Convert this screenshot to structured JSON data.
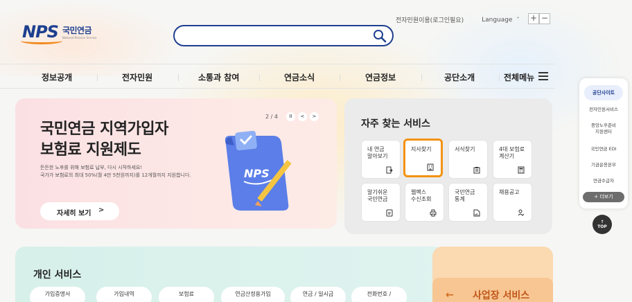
{
  "header": {
    "logo_text": "NPS",
    "logo_kr": "국민연금",
    "logo_en": "National Pension Service",
    "search_placeholder": "",
    "util_login": "전자민원이용(로그인필요)",
    "util_language": "Language",
    "zoom_in": "+",
    "zoom_out": "−"
  },
  "nav": {
    "items": [
      "정보공개",
      "전자민원",
      "소통과 참여",
      "연금소식",
      "연금정보",
      "공단소개",
      "전체메뉴"
    ]
  },
  "hero": {
    "title_line1": "국민연금 지역가입자",
    "title_line2": "보험료 지원제도",
    "desc_line1": "든든한 노후를 위해 보험료 납부, 다시 시작하세요!",
    "desc_line2": "국가가 보험료의 최대 50%(월 4만 5천원까지)를 12개월까지 지원합니다.",
    "button_label": "자세히 보기",
    "button_arrow": ">",
    "pager": "2 / 4",
    "pause": "II",
    "prev": "<",
    "next": ">",
    "illust_logo": "NPS"
  },
  "frequent": {
    "title": "자주 찾는 서비스",
    "tiles": [
      {
        "label": "내 연금\n알아보기",
        "icon": "document-arrow-icon"
      },
      {
        "label": "지사찾기",
        "icon": "building-icon"
      },
      {
        "label": "서식찾기",
        "icon": "clipboard-icon"
      },
      {
        "label": "4대 보험료\n계산기",
        "icon": "calculator-icon"
      },
      {
        "label": "알기쉬운\n국민연금",
        "icon": "book-icon"
      },
      {
        "label": "웹팩스\n수신조회",
        "icon": "printer-icon"
      },
      {
        "label": "국민연금\n통계",
        "icon": "chart-doc-icon"
      },
      {
        "label": "채용공고",
        "icon": "person-check-icon"
      }
    ],
    "highlighted_index": 1,
    "highlight_color": "#f39212"
  },
  "quick": {
    "head": "공단사이트",
    "items": [
      "전자민원서비스",
      "중앙노후준비\n지원센터",
      "국민연금 EDI",
      "기금운용본부",
      "연금수급자"
    ],
    "more": "+ 더보기",
    "top": "TOP"
  },
  "personal": {
    "title": "개인 서비스",
    "tabs": [
      "가입증명서",
      "가입내역",
      "보험료",
      "연금산정용가입",
      "연금 / 일시금",
      "전화번호 /"
    ]
  },
  "business": {
    "arrow": "←",
    "title": "사업장 서비스"
  },
  "colors": {
    "brand_blue": "#1e3f8f",
    "brand_orange": "#f28a1e"
  }
}
